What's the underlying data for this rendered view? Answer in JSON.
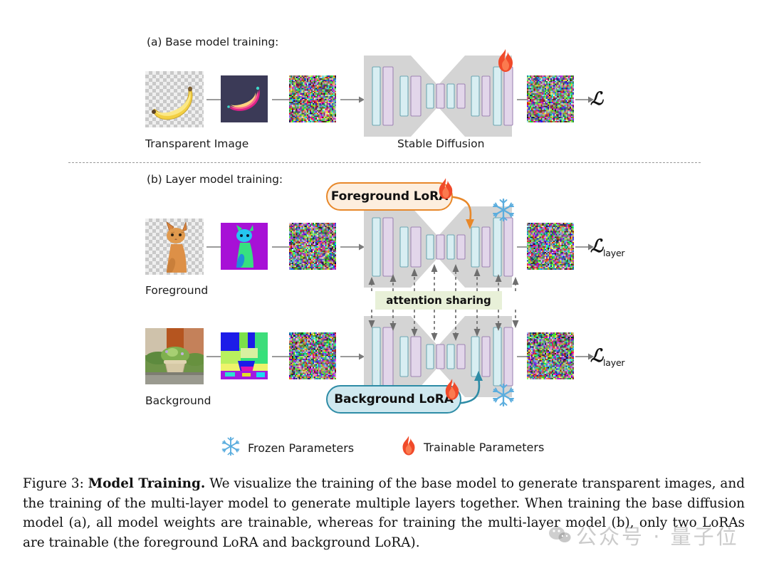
{
  "figure": {
    "sections": {
      "a": {
        "title": "(a) Base model training:"
      },
      "b": {
        "title": "(b) Layer model training:"
      }
    },
    "rows": {
      "base": {
        "input_caption": "Transparent Image",
        "model_caption": "Stable Diffusion",
        "loss": "ℒ",
        "loss_sub": ""
      },
      "foreground": {
        "input_caption": "Foreground",
        "loss": "ℒ",
        "loss_sub": "layer"
      },
      "background": {
        "input_caption": "Background",
        "loss": "ℒ",
        "loss_sub": "layer"
      }
    },
    "badges": {
      "foreground_lora": "Foreground LoRA",
      "background_lora": "Background LoRA"
    },
    "attention_sharing_label": "attention sharing",
    "legend": [
      {
        "icon": "snowflake-icon",
        "label": "Frozen Parameters",
        "color": "#5badde"
      },
      {
        "icon": "flame-icon",
        "label": "Trainable Parameters",
        "color": "#f04a2a"
      }
    ],
    "colors": {
      "unet_body": "#d4d4d4",
      "block_blue_fill": "#d8eef2",
      "block_blue_stroke": "#6fa8b4",
      "block_purple_fill": "#e2d6ea",
      "block_purple_stroke": "#9f86b4",
      "lora_fg_fill": "#fdeede",
      "lora_fg_stroke": "#e8882a",
      "lora_bg_fill": "#cfe8ef",
      "lora_bg_stroke": "#2e8ca6",
      "attention_band": "#e8f0d8",
      "arrow_gray": "#7a7a7a",
      "flame": "#f04a2a",
      "snowflake": "#5badde"
    }
  },
  "caption": {
    "label": "Figure 3:",
    "bold_title": "Model Training.",
    "body": " We visualize the training of the base model to generate transparent images, and the training of the multi-layer model to generate multiple layers together. When training the base diffusion model (a), all model weights are trainable, whereas for training the multi-layer model (b), only two LoRAs are trainable (the foreground LoRA and background LoRA)."
  },
  "watermark": {
    "text": "公众号 · 量子位"
  }
}
